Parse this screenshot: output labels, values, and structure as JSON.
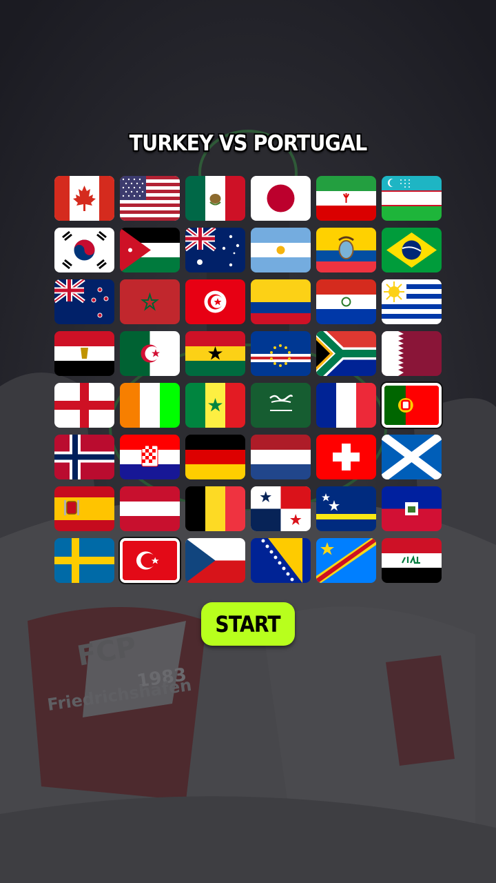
{
  "match": {
    "title": "TURKEY VS PORTUGAL"
  },
  "start_button": {
    "label": "START",
    "color": "#b8ff1d"
  },
  "selection": {
    "home": "turkey",
    "away": "portugal"
  },
  "flags": [
    "canada",
    "usa",
    "mexico",
    "japan",
    "iran",
    "uzbekistan",
    "south-korea",
    "jordan",
    "australia",
    "argentina",
    "ecuador",
    "brazil",
    "new-zealand",
    "morocco",
    "tunisia",
    "colombia",
    "paraguay",
    "uruguay",
    "egypt",
    "algeria",
    "ghana",
    "cape-verde",
    "south-africa",
    "qatar",
    "england",
    "ivory-coast",
    "senegal",
    "saudi-arabia",
    "france",
    "portugal",
    "norway",
    "croatia",
    "germany",
    "netherlands",
    "switzerland",
    "scotland",
    "spain",
    "austria",
    "belgium",
    "panama",
    "curacao",
    "haiti",
    "sweden",
    "turkey",
    "czechia",
    "bosnia",
    "dr-congo",
    "iraq"
  ],
  "background_text": {
    "crest_year": "1983",
    "crest_name": "Friedrichshafen",
    "crest_initials": "FCP"
  }
}
